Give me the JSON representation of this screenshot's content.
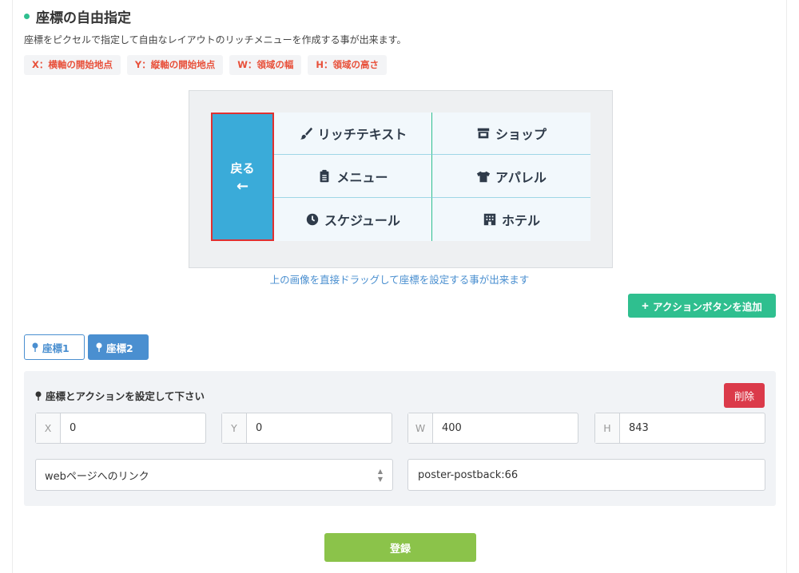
{
  "section": {
    "title": "座標の自由指定",
    "description": "座標をピクセルで指定して自由なレイアウトのリッチメニューを作成する事が出来ます。"
  },
  "tags": [
    "X：横軸の開始地点",
    "Y：縦軸の開始地点",
    "W：領域の幅",
    "H：領域の高さ"
  ],
  "preview": {
    "back_label": "戻る",
    "back_arrow": "←",
    "cells": [
      {
        "label": "リッチテキスト",
        "icon": "brush-icon"
      },
      {
        "label": "ショップ",
        "icon": "store-icon"
      },
      {
        "label": "メニュー",
        "icon": "clipboard-icon"
      },
      {
        "label": "アパレル",
        "icon": "tshirt-icon"
      },
      {
        "label": "スケジュール",
        "icon": "clock-icon"
      },
      {
        "label": "ホテル",
        "icon": "hotel-icon"
      }
    ],
    "hint": "上の画像を直接ドラッグして座標を設定する事が出来ます"
  },
  "actions": {
    "add_button": "アクションボタンを追加",
    "add_icon": "+"
  },
  "coord_tabs": [
    {
      "label": "座標1",
      "active": false
    },
    {
      "label": "座標2",
      "active": true
    }
  ],
  "form": {
    "heading": "座標とアクションを設定して下さい",
    "delete_button": "削除",
    "fields": [
      {
        "prefix": "X",
        "value": "0"
      },
      {
        "prefix": "Y",
        "value": "0"
      },
      {
        "prefix": "W",
        "value": "400"
      },
      {
        "prefix": "H",
        "value": "843"
      }
    ],
    "action_type": "webページへのリンク",
    "action_value": "poster-postback:66"
  },
  "submit_button": "登録",
  "colors": {
    "accent_green": "#2fbf8f",
    "tag_red": "#e8503a",
    "blue": "#4a8fd0",
    "menu_blue": "#3aabd9",
    "delete_red": "#db3a4a",
    "submit_green": "#8bc34a"
  }
}
